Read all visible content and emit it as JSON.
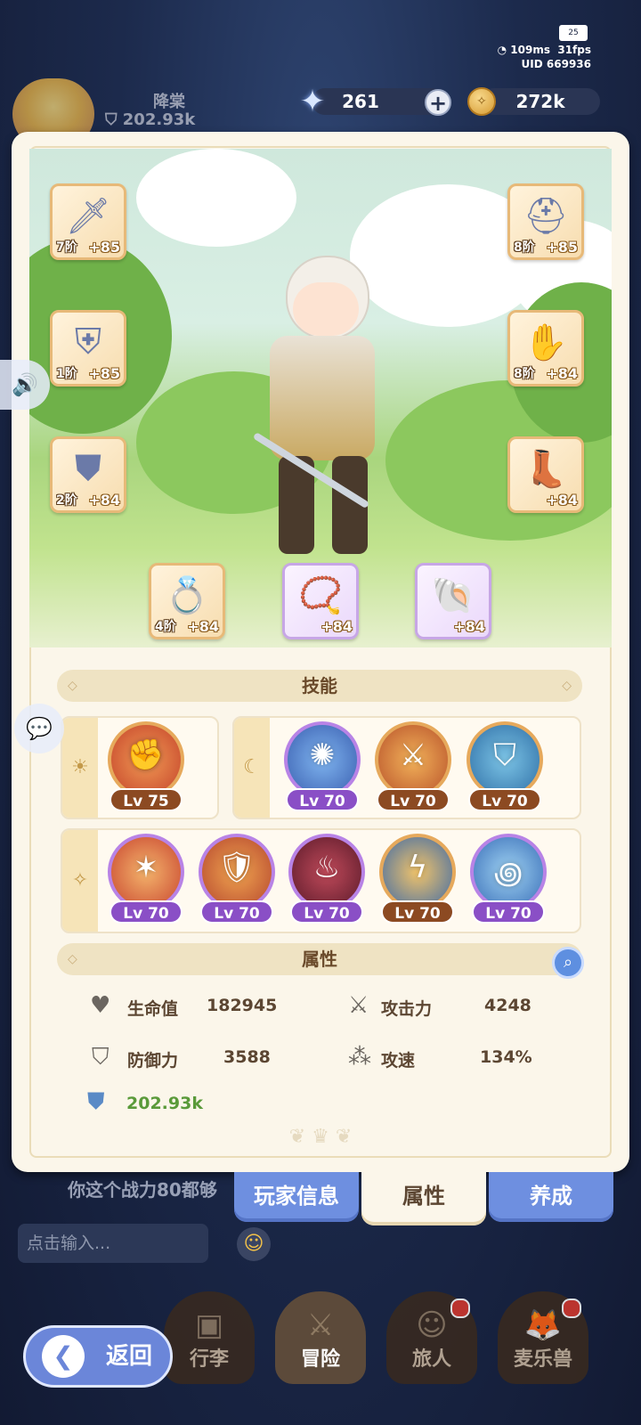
{
  "status": {
    "battery": "25",
    "ping": "109ms",
    "fps": "31fps",
    "uid": "UID 669936"
  },
  "hud": {
    "player_name": "降棠",
    "player_power": "202.93k",
    "star_count": "261",
    "coin_count": "272k"
  },
  "equipment": [
    {
      "slot": "weapon",
      "icon": "sword-icon",
      "tier": "7阶",
      "plus": "+85",
      "rarity": "orange"
    },
    {
      "slot": "armor",
      "icon": "chestplate-icon",
      "tier": "1阶",
      "plus": "+85",
      "rarity": "orange"
    },
    {
      "slot": "pants",
      "icon": "leg-armor-icon",
      "tier": "2阶",
      "plus": "+84",
      "rarity": "orange"
    },
    {
      "slot": "helmet",
      "icon": "helmet-icon",
      "tier": "8阶",
      "plus": "+85",
      "rarity": "orange"
    },
    {
      "slot": "gloves",
      "icon": "gauntlet-icon",
      "tier": "8阶",
      "plus": "+84",
      "rarity": "orange"
    },
    {
      "slot": "boots",
      "icon": "boots-icon",
      "tier": "",
      "plus": "+84",
      "rarity": "orange"
    },
    {
      "slot": "ring",
      "icon": "ring-icon",
      "tier": "4阶",
      "plus": "+84",
      "rarity": "orange"
    },
    {
      "slot": "necklace",
      "icon": "necklace-icon",
      "tier": "",
      "plus": "+84",
      "rarity": "purple"
    },
    {
      "slot": "charm",
      "icon": "charm-icon",
      "tier": "",
      "plus": "+84",
      "rarity": "purple"
    }
  ],
  "skills": {
    "title": "技能",
    "sun_group": [
      {
        "level": "Lv 75",
        "color": "orange",
        "icon": "fist-burst-icon"
      }
    ],
    "moon_group": [
      {
        "level": "Lv 70",
        "color": "purple",
        "icon": "power-aura-icon"
      },
      {
        "level": "Lv 70",
        "color": "orange",
        "icon": "blade-strike-icon"
      },
      {
        "level": "Lv 70",
        "color": "orange",
        "icon": "shield-wall-icon"
      }
    ],
    "star_group": [
      {
        "level": "Lv 70",
        "color": "purple",
        "icon": "slash-icon"
      },
      {
        "level": "Lv 70",
        "color": "purple",
        "icon": "sword-shield-icon"
      },
      {
        "level": "Lv 70",
        "color": "purple",
        "icon": "rage-icon"
      },
      {
        "level": "Lv 70",
        "color": "orange",
        "icon": "lightning-icon"
      },
      {
        "level": "Lv 70",
        "color": "purple",
        "icon": "whirlwind-icon"
      }
    ]
  },
  "attributes": {
    "title": "属性",
    "hp_label": "生命值",
    "hp_value": "182945",
    "atk_label": "攻击力",
    "atk_value": "4248",
    "def_label": "防御力",
    "def_value": "3588",
    "spd_label": "攻速",
    "spd_value": "134%",
    "power_value": "202.93k"
  },
  "tabs": {
    "player_info": "玩家信息",
    "attributes": "属性",
    "develop": "养成"
  },
  "chat": {
    "last_message": "你这个战力80都够",
    "input_placeholder": "点击输入..."
  },
  "nav": {
    "back": "返回",
    "bag": "行李",
    "adventure": "冒险",
    "traveler": "旅人",
    "pet": "麦乐兽"
  },
  "colors": {
    "accent_blue": "#6e8fe0",
    "panel_bg": "#fbf6ea",
    "level_orange": "#8c4a22",
    "level_purple": "#8a4fc6",
    "power_green": "#5a9a3a"
  }
}
